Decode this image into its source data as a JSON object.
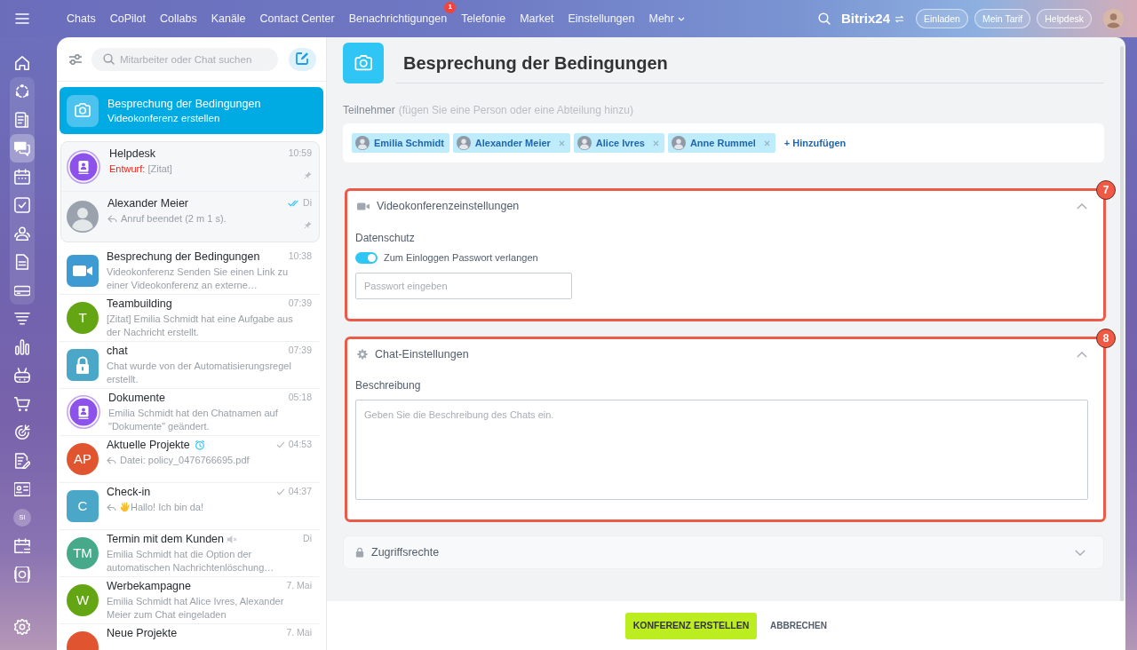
{
  "top_nav": {
    "items": [
      {
        "label": "Chats"
      },
      {
        "label": "CoPilot"
      },
      {
        "label": "Collabs"
      },
      {
        "label": "Kanäle"
      },
      {
        "label": "Contact Center"
      },
      {
        "label": "Benachrichtigungen",
        "badge": "1"
      },
      {
        "label": "Telefonie"
      },
      {
        "label": "Market"
      },
      {
        "label": "Einstellungen"
      }
    ],
    "more": "Mehr",
    "brand": "Bitrix24",
    "buttons": [
      "Einladen",
      "Mein Tarif",
      "Helpdesk"
    ]
  },
  "rail": {
    "start": [
      {
        "kind": "home",
        "selected": false
      }
    ],
    "group": [
      {
        "kind": "network",
        "selected": false
      },
      {
        "kind": "feed",
        "selected": false
      },
      {
        "kind": "chat",
        "selected": true
      },
      {
        "kind": "calendar",
        "selected": false
      },
      {
        "kind": "tasks",
        "selected": false
      },
      {
        "kind": "people",
        "selected": false
      },
      {
        "kind": "document",
        "selected": false
      },
      {
        "kind": "drive",
        "selected": false
      }
    ],
    "rest": [
      {
        "kind": "funnel",
        "selected": false
      },
      {
        "kind": "chart",
        "selected": false
      },
      {
        "kind": "robot",
        "selected": false
      },
      {
        "kind": "cart",
        "selected": false
      },
      {
        "kind": "target",
        "selected": false
      },
      {
        "kind": "signature",
        "selected": false
      },
      {
        "kind": "card",
        "selected": false
      },
      {
        "kind": "avatar",
        "initials": "SI",
        "selected": false
      },
      {
        "kind": "schedule",
        "selected": false
      },
      {
        "kind": "disk",
        "selected": false
      }
    ],
    "bottom": [
      {
        "kind": "settings",
        "selected": false
      }
    ]
  },
  "chat_list": {
    "search": {
      "placeholder": "Mitarbeiter oder Chat suchen"
    },
    "draft_item": {
      "title": "Besprechung der Bedingungen",
      "subtitle": "Videokonferenz erstellen",
      "selected": true
    },
    "chats": [
      {
        "title": "Helpdesk",
        "time": "10:59",
        "draft": "Entwurf:",
        "preview": "[Zitat]",
        "avatar": {
          "kind": "book",
          "color": "#8e52ec"
        },
        "pinned": true
      },
      {
        "title": "Alexander Meier",
        "time": "Di",
        "read": true,
        "reply": true,
        "preview": "Anruf beendet (2 m 1 s).",
        "avatar": {
          "kind": "photo"
        },
        "pinned": true
      },
      {
        "title": "Besprechung der Bedingungen",
        "time": "10:38",
        "preview": "Videokonferenz Senden Sie einen Link zu einer Videokonferenz an externe…",
        "avatar": {
          "kind": "video",
          "color": "#3d9ad3"
        },
        "pinned": false
      },
      {
        "title": "Teambuilding",
        "time": "07:39",
        "preview": "[Zitat] Emilia Schmidt hat eine Aufgabe aus der Nachricht erstellt.",
        "avatar": {
          "kind": "circle",
          "initials": "T",
          "color": "#64a513"
        },
        "pinned": false
      },
      {
        "title": "chat",
        "time": "07:39",
        "preview": "Chat wurde von der Automatisierungsregel erstellt.",
        "avatar": {
          "kind": "lock",
          "color": "#4ba7c7"
        },
        "pinned": false
      },
      {
        "title": "Dokumente",
        "time": "05:18",
        "preview": "Emilia Schmidt hat den Chatnamen auf \"Dokumente\" geändert.",
        "avatar": {
          "kind": "book",
          "color": "#8e52ec"
        },
        "pinned": false
      },
      {
        "title": "Aktuelle Projekte",
        "timer": true,
        "time": "04:53",
        "sent": true,
        "reply": true,
        "preview": "Datei: policy_0476766695.pdf",
        "avatar": {
          "kind": "circle",
          "initials": "AP",
          "color": "#e0552f"
        },
        "pinned": false
      },
      {
        "title": "Check-in",
        "time": "04:37",
        "sent": true,
        "reply": true,
        "emoji": true,
        "preview": "Hallo! Ich bin da!",
        "avatar": {
          "kind": "square",
          "initials": "C",
          "color": "#4ba7c7"
        },
        "pinned": false
      },
      {
        "title": "Termin mit dem Kunden",
        "muted": true,
        "time": "Di",
        "preview": "Emilia Schmidt hat die Option der automatischen Nachrichtenlöschung…",
        "avatar": {
          "kind": "circle",
          "initials": "TM",
          "color": "#46a98a"
        },
        "pinned": false
      },
      {
        "title": "Werbekampagne",
        "time": "7. Mai",
        "preview": "Emilia Schmidt hat Alice Ivres, Alexander Meier zum Chat eingeladen",
        "avatar": {
          "kind": "circle",
          "initials": "W",
          "color": "#64a513"
        },
        "pinned": false
      },
      {
        "title": "Neue Projekte",
        "time": "7. Mai",
        "avatar": {
          "kind": "circle",
          "color": "#e0552f"
        },
        "pinned": false
      }
    ]
  },
  "conference": {
    "title": "Besprechung der Bedingungen",
    "participants": {
      "label": "Teilnehmer",
      "hint": "(fügen Sie eine Person oder eine Abteilung hinzu)",
      "people": [
        {
          "name": "Emilia Schmidt",
          "removable": false
        },
        {
          "name": "Alexander Meier",
          "removable": true
        },
        {
          "name": "Alice Ivres",
          "removable": true
        },
        {
          "name": "Anne Rummel",
          "removable": true
        }
      ],
      "add": "+ Hinzufügen"
    },
    "sections": [
      {
        "kind": "video",
        "title": "Videokonferenzeinstellungen",
        "expanded": true,
        "callout": "7",
        "label": "Datenschutz",
        "toggle": {
          "label": "Zum Einloggen Passwort verlangen",
          "on": true
        },
        "input": {
          "placeholder": "Passwort eingeben"
        }
      },
      {
        "kind": "chat",
        "title": "Chat-Einstellungen",
        "expanded": true,
        "callout": "8",
        "label": "Beschreibung",
        "textarea": {
          "placeholder": "Geben Sie die Beschreibung des Chats ein."
        }
      },
      {
        "kind": "access",
        "title": "Zugriffsrechte",
        "expanded": false
      }
    ]
  },
  "footer": {
    "buttons": [
      {
        "label": "KONFERENZ ERSTELLEN",
        "kind": "primary"
      },
      {
        "label": "ABBRECHEN",
        "kind": "link"
      }
    ]
  }
}
